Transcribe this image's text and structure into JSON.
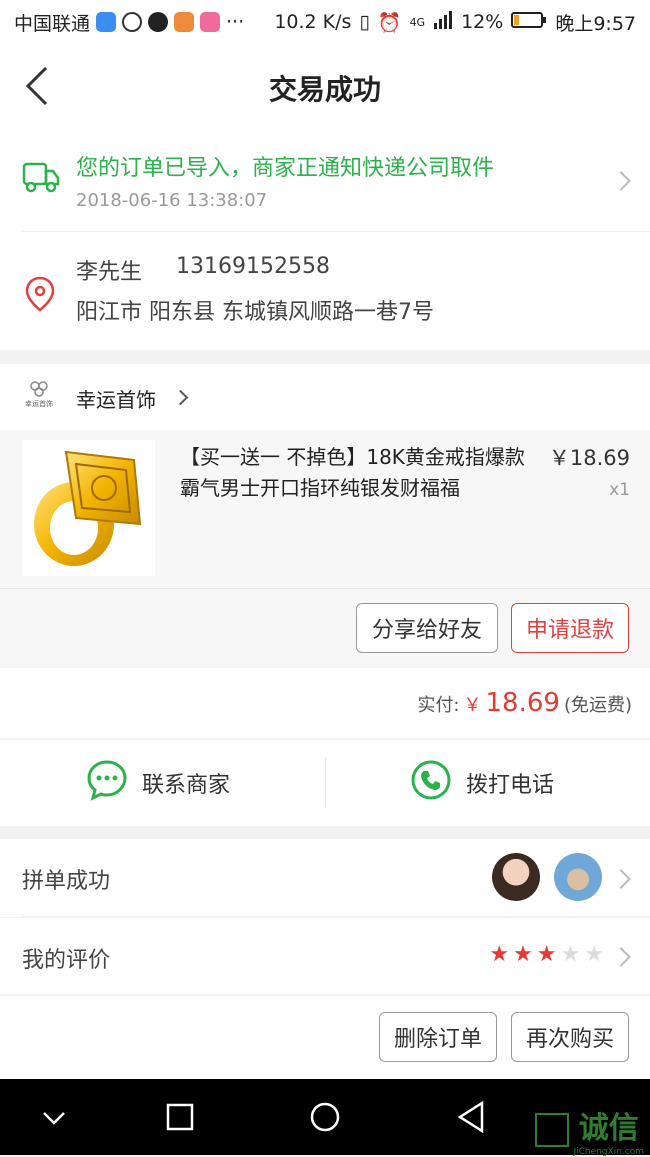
{
  "status_bar": {
    "carrier": "中国联通",
    "more": "···",
    "speed": "10.2 K/s",
    "network": "4G",
    "battery": "12%",
    "time": "晚上9:57"
  },
  "nav": {
    "title": "交易成功",
    "back_icon": "chevron-left-icon"
  },
  "logistics": {
    "message": "您的订单已导入，商家正通知快递公司取件",
    "time": "2018-06-16 13:38:07",
    "icon": "truck-icon",
    "accent": "#2bb24c"
  },
  "address": {
    "name": "李先生",
    "phone": "13169152558",
    "detail": "阳江市 阳东县 东城镇风顺路一巷7号",
    "icon": "location-pin-icon",
    "icon_color": "#e04040"
  },
  "shop": {
    "name": "幸运首饰",
    "logo_text": "幸运首饰"
  },
  "product": {
    "title": "【买一送一 不掉色】18K黄金戒指爆款霸气男士开口指环纯银发财福福",
    "price": "￥18.69",
    "quantity": "x1"
  },
  "item_actions": {
    "share_label": "分享给好友",
    "refund_label": "申请退款"
  },
  "total": {
    "label": "实付:",
    "currency": "￥",
    "amount": "18.69",
    "shipping_note": "(免运费)",
    "accent": "#e53935"
  },
  "contact": {
    "merchant_label": "联系商家",
    "phone_label": "拨打电话",
    "icon_color": "#2bb24c"
  },
  "group_buy": {
    "label": "拼单成功"
  },
  "review": {
    "label": "我的评价",
    "rating": 3,
    "max": 5,
    "star_color": "#e53935"
  },
  "bottom_actions": {
    "delete_label": "删除订单",
    "rebuy_label": "再次购买"
  },
  "watermark": {
    "text": "诚信",
    "url_text": "JiChengXin.com"
  }
}
